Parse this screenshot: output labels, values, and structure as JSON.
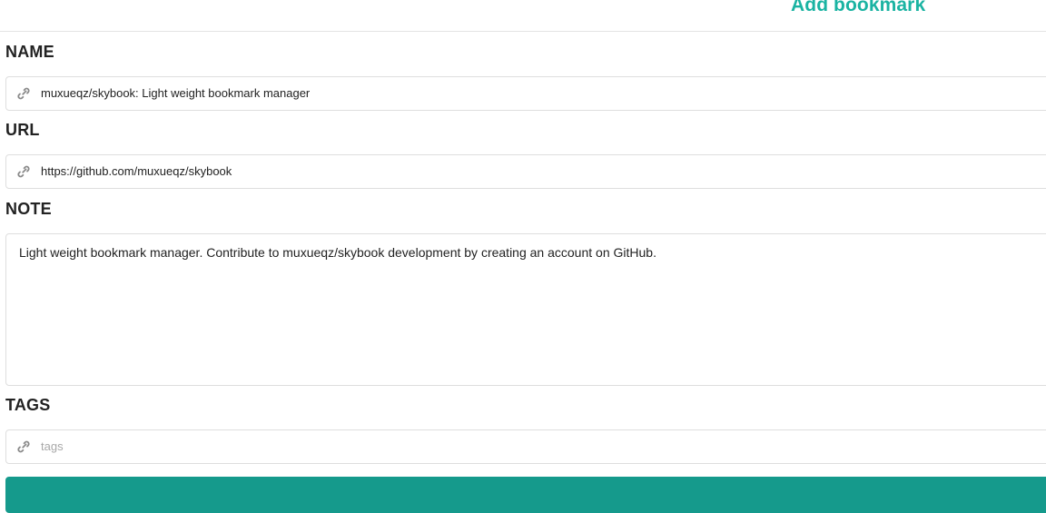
{
  "header": {
    "title": "Add bookmark"
  },
  "form": {
    "name": {
      "label": "NAME",
      "icon": "link-icon",
      "value": "muxueqz/skybook: Light weight bookmark manager"
    },
    "url": {
      "label": "URL",
      "icon": "link-icon",
      "value": "https://github.com/muxueqz/skybook"
    },
    "note": {
      "label": "NOTE",
      "value": "Light weight bookmark manager. Contribute to muxueqz/skybook development by creating an account on GitHub."
    },
    "tags": {
      "label": "TAGS",
      "icon": "link-icon",
      "value": "",
      "placeholder": "tags"
    },
    "submit": {
      "label": " "
    }
  },
  "colors": {
    "accent": "#1ab3a2",
    "button": "#159a8c",
    "border": "#dedede"
  }
}
